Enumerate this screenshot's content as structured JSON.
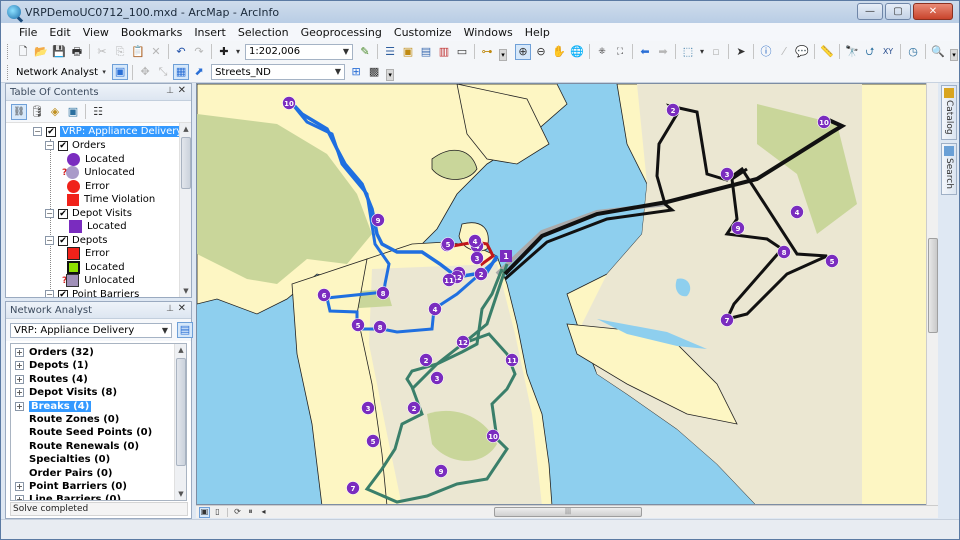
{
  "window": {
    "title": "VRPDemoUC0712_100.mxd - ArcMap - ArcInfo",
    "controls": {
      "minimize": "—",
      "maximize": "▢",
      "close": "✕"
    }
  },
  "menubar": [
    "File",
    "Edit",
    "View",
    "Bookmarks",
    "Insert",
    "Selection",
    "Geoprocessing",
    "Customize",
    "Windows",
    "Help"
  ],
  "standard_toolbar": {
    "scale": "1:202,006",
    "icons": [
      "new-icon",
      "open-icon",
      "save-icon",
      "print-icon",
      "cut-icon",
      "copy-icon",
      "paste-icon",
      "delete-icon",
      "undo-icon",
      "redo-icon",
      "add-data-icon",
      "scale-dropdown",
      "editor-icon",
      "toc-icon",
      "catalog-icon",
      "search-window-icon",
      "arctoolbox-icon",
      "python-icon",
      "modelbuilder-icon",
      "zoom-in-icon",
      "zoom-out-icon",
      "pan-icon",
      "full-extent-icon",
      "fixed-zoom-in-icon",
      "fixed-zoom-out-icon",
      "back-icon",
      "forward-icon",
      "select-features-icon",
      "clear-selection-icon",
      "select-elements-icon",
      "identify-icon",
      "hyperlink-icon",
      "html-popup-icon",
      "measure-icon",
      "find-icon",
      "find-route-icon",
      "go-to-xy-icon",
      "time-slider-icon",
      "create-viewer-icon"
    ]
  },
  "network_toolbar": {
    "label": "Network Analyst",
    "network_dataset": "Streets_ND"
  },
  "toc": {
    "title": "Table Of Contents",
    "layer": "VRP: Appliance Delivery",
    "groups": [
      {
        "name": "Orders",
        "items": [
          {
            "label": "Located",
            "symbol": "circle",
            "color": "#7a2cbf"
          },
          {
            "label": "Unlocated",
            "symbol": "circle-q",
            "color": "#a99ac9"
          },
          {
            "label": "Error",
            "symbol": "circle",
            "color": "#f0221a"
          },
          {
            "label": "Time Violation",
            "symbol": "square",
            "color": "#f0221a"
          }
        ]
      },
      {
        "name": "Depot Visits",
        "items": [
          {
            "label": "Located",
            "symbol": "square",
            "color": "#7a2cbf"
          }
        ]
      },
      {
        "name": "Depots",
        "items": [
          {
            "label": "Error",
            "symbol": "square-outline",
            "color": "#f0221a"
          },
          {
            "label": "Located",
            "symbol": "square-outline",
            "color": "#8ee000"
          },
          {
            "label": "Unlocated",
            "symbol": "square-q",
            "color": "#a090b8"
          }
        ]
      },
      {
        "name": "Point Barriers",
        "items": []
      }
    ]
  },
  "network_analyst": {
    "title": "Network Analyst",
    "analysis": "VRP: Appliance Delivery",
    "classes": [
      {
        "label": "Orders (32)",
        "expandable": true
      },
      {
        "label": "Depots (1)",
        "expandable": true
      },
      {
        "label": "Routes (4)",
        "expandable": true
      },
      {
        "label": "Depot Visits (8)",
        "expandable": true
      },
      {
        "label": "Breaks (4)",
        "expandable": true,
        "selected": true
      },
      {
        "label": "Route Zones (0)",
        "expandable": false
      },
      {
        "label": "Route Seed Points (0)",
        "expandable": false
      },
      {
        "label": "Route Renewals (0)",
        "expandable": false
      },
      {
        "label": "Specialties (0)",
        "expandable": false
      },
      {
        "label": "Order Pairs (0)",
        "expandable": false
      },
      {
        "label": "Point Barriers (0)",
        "expandable": true
      },
      {
        "label": "Line Barriers (0)",
        "expandable": true
      }
    ],
    "status": "Solve completed"
  },
  "side_tabs": [
    "Catalog",
    "Search"
  ],
  "map": {
    "colors": {
      "water": "#8ecfee",
      "land": "#fdf6c3",
      "park": "#c9d69a",
      "urban": "#e9e6d4"
    },
    "routes": [
      {
        "name": "blue-route",
        "color": "#1f6fe0",
        "stops": [
          "1",
          "2",
          "3",
          "4",
          "5",
          "6",
          "7",
          "8",
          "9",
          "10",
          "11",
          "12"
        ]
      },
      {
        "name": "red-route",
        "color": "#c0181a",
        "stops": [
          "2",
          "3",
          "4",
          "5"
        ]
      },
      {
        "name": "green-route",
        "color": "#3a7f6a",
        "stops": [
          "2",
          "3",
          "4",
          "5",
          "6",
          "7",
          "9",
          "10",
          "11",
          "12"
        ]
      },
      {
        "name": "black-route",
        "color": "#111111",
        "stops": [
          "2",
          "3",
          "4",
          "5",
          "7",
          "8",
          "9",
          "10"
        ]
      }
    ],
    "depot_label": "1",
    "stop_color": "#7a2cbf"
  }
}
